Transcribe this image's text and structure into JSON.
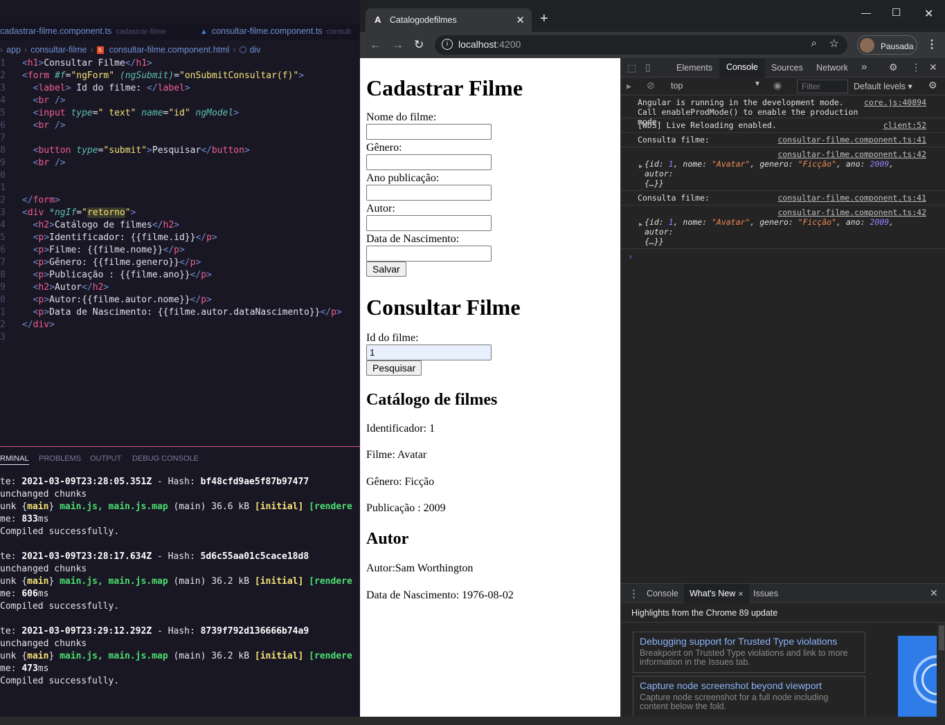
{
  "vscode": {
    "tabs": [
      {
        "file": "cadastrar-filme.component.ts",
        "folder": "cadastrar-filme"
      },
      {
        "file": "consultar-filme.component.ts",
        "folder": "consult"
      }
    ],
    "breadcrumb": [
      "app",
      "consultar-filme",
      "consultar-filme.component.html",
      "div"
    ],
    "line_numbers": [
      "1",
      "2",
      "3",
      "4",
      "5",
      "6",
      "7",
      "8",
      "9",
      "0",
      "1",
      "2",
      "3",
      "4",
      "5",
      "6",
      "7",
      "8",
      "9",
      "0",
      "1",
      "2",
      "3"
    ],
    "terminal_tabs": [
      "RMINAL",
      "PROBLEMS",
      "OUTPUT",
      "DEBUG CONSOLE"
    ],
    "builds": [
      {
        "date_prefix": "te: ",
        "date": "2021-03-09T23:28:05.351Z",
        "hash_label": " - Hash: ",
        "hash": "bf48cfd9ae5f87b97477",
        "unchanged": "unchanged chunks",
        "chunk_prefix": "unk ",
        "chunk_open": "{",
        "chunk_name": "main",
        "chunk_close": "}",
        "files": " main.js, main.js.map",
        "size": " (main) 36.6 kB ",
        "initial": "[initial]",
        "rendered": " [rendere",
        "time_label": "me: ",
        "time": "833",
        "time_unit": "ms",
        "compiled": "Compiled successfully."
      },
      {
        "date_prefix": "te: ",
        "date": "2021-03-09T23:28:17.634Z",
        "hash_label": " - Hash: ",
        "hash": "5d6c55aa01c5cace18d8",
        "unchanged": "unchanged chunks",
        "chunk_prefix": "unk ",
        "chunk_open": "{",
        "chunk_name": "main",
        "chunk_close": "}",
        "files": " main.js, main.js.map",
        "size": " (main) 36.2 kB ",
        "initial": "[initial]",
        "rendered": " [rendere",
        "time_label": "me: ",
        "time": "606",
        "time_unit": "ms",
        "compiled": "Compiled successfully."
      },
      {
        "date_prefix": "te: ",
        "date": "2021-03-09T23:29:12.292Z",
        "hash_label": " - Hash: ",
        "hash": "8739f792d136666b74a9",
        "unchanged": "unchanged chunks",
        "chunk_prefix": "unk ",
        "chunk_open": "{",
        "chunk_name": "main",
        "chunk_close": "}",
        "files": " main.js, main.js.map",
        "size": " (main) 36.2 kB ",
        "initial": "[initial]",
        "rendered": " [rendere",
        "time_label": "me: ",
        "time": "473",
        "time_unit": "ms",
        "compiled": "Compiled successfully."
      }
    ]
  },
  "chrome": {
    "tab_title": "Catalogodefilmes",
    "tab_favicon": "A",
    "url_host": "localhost",
    "url_port": ":4200",
    "profile_label": "Pausada"
  },
  "page": {
    "cadastrar_title": "Cadastrar Filme",
    "fields": [
      "Nome do filme:",
      "Gênero:",
      "Ano publicação:",
      "Autor:",
      "Data de Nascimento:"
    ],
    "save_label": "Salvar",
    "consultar_title": "Consultar Filme",
    "id_label": "Id do filme:",
    "id_value": "1",
    "search_label": "Pesquisar",
    "catalog_title": "Catálogo de filmes",
    "identificador": "Identificador: 1",
    "filme": "Filme: Avatar",
    "genero": "Gênero: Ficção",
    "publicacao": "Publicação : 2009",
    "autor_title": "Autor",
    "autor": "Autor:Sam Worthington",
    "nascimento": "Data de Nascimento: 1976-08-02"
  },
  "devtools": {
    "tabs": [
      "Elements",
      "Console",
      "Sources",
      "Network"
    ],
    "more": "»",
    "context": "top",
    "filter_placeholder": "Filter",
    "levels": "Default levels",
    "messages": {
      "angular_text": "Angular is running in the development mode. Call enableProdMode() to enable the production mode.",
      "angular_src": "core.js:40894",
      "wds_text": "[WDS] Live Reloading enabled.",
      "wds_src": "client:52",
      "consulta_label": "Consulta filme:",
      "src41": "consultar-filme.component.ts:41",
      "src42": "consultar-filme.component.ts:42",
      "obj_open": "{",
      "k_id": "id: ",
      "v_id": "1",
      "k_nome": ", nome: ",
      "v_nome": "\"Avatar\"",
      "k_genero": ", genero: ",
      "v_genero": "\"Ficção\"",
      "k_ano": ", ano: ",
      "v_ano": "2009",
      "k_autor": ", autor:",
      "obj_close": "{…}}"
    },
    "drawer_tabs": [
      "Console",
      "What's New",
      "Issues"
    ],
    "highlights": "Highlights from the Chrome 89 update",
    "cards": [
      {
        "title": "Debugging support for Trusted Type violations",
        "desc": "Breakpoint on Trusted Type violations and link to more information in the Issues tab."
      },
      {
        "title": "Capture node screenshot beyond viewport",
        "desc": "Capture node screenshot for a full node including content below the fold."
      }
    ]
  }
}
